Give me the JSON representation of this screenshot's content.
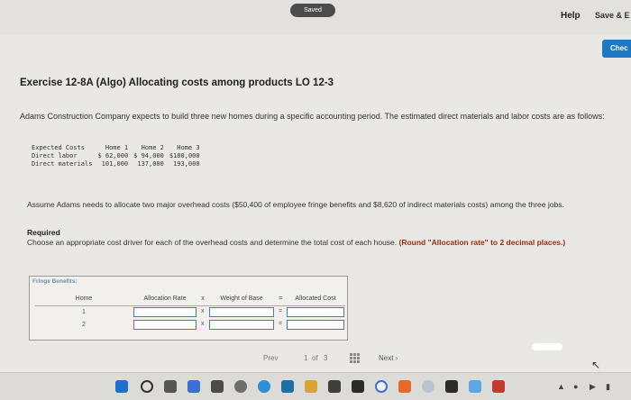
{
  "header": {
    "saved": "Saved",
    "help": "Help",
    "save_exit": "Save & E",
    "check": "Chec"
  },
  "exercise": {
    "title": "Exercise 12-8A (Algo) Allocating costs among products LO 12-3",
    "intro": "Adams Construction Company expects to build three new homes during a specific accounting period. The estimated direct materials and labor costs are as follows:"
  },
  "cost_table": {
    "headers": [
      "Expected Costs",
      "Home 1",
      "Home 2",
      "Home 3"
    ],
    "rows": [
      [
        "Direct labor",
        "$ 62,000",
        "$ 94,000",
        "$180,000"
      ],
      [
        "Direct materials",
        "101,000",
        "137,000",
        "193,000"
      ]
    ]
  },
  "assume": "Assume Adams needs to allocate two major overhead costs ($50,400 of employee fringe benefits and $8,620 of indirect materials costs) among the three jobs.",
  "required": {
    "heading": "Required",
    "text": "Choose an appropriate cost driver for each of the overhead costs and determine the total cost of each house.",
    "note": "(Round \"Allocation rate\" to 2 decimal places.)"
  },
  "worksheet": {
    "section": "Fringe Benefits:",
    "headers": {
      "home": "Home",
      "rate": "Allocation Rate",
      "times": "x",
      "base": "Weight of Base",
      "equals": "=",
      "cost": "Allocated Cost"
    },
    "rows": [
      {
        "home": "1",
        "times": "x",
        "equals": "="
      },
      {
        "home": "2",
        "times": "x",
        "equals": "="
      }
    ]
  },
  "pager": {
    "prev": "Prev",
    "page": "1",
    "of": "of",
    "total": "3",
    "next": "Next"
  },
  "colors": {
    "accent": "#1f77c2",
    "required_note": "#9a2b12",
    "input_border": "#3a7bd5"
  }
}
